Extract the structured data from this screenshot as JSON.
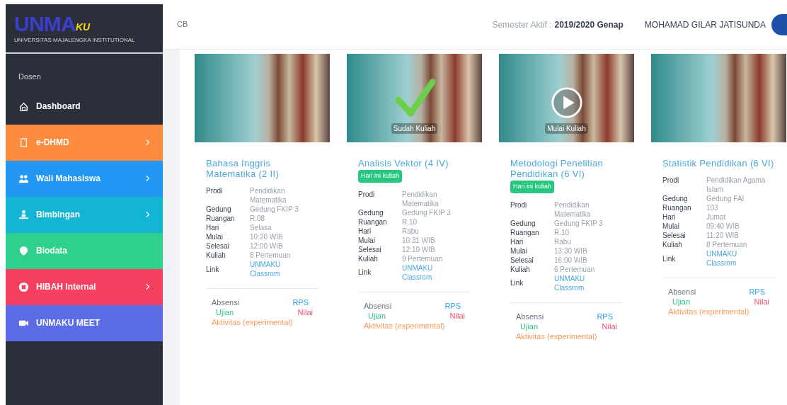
{
  "logo": {
    "text": "UNMA",
    "accent": "KU",
    "tagline": "UNIVERSITAS MAJALENGKA INSTITUTIONAL"
  },
  "header": {
    "toggle": "CB",
    "semester_label": "Semester Aktif :",
    "semester_value": "2019/2020 Genap",
    "user": "MOHAMAD GILAR JATISUNDA"
  },
  "sidebar": {
    "section": "Dosen",
    "items": [
      {
        "label": "Dashboard",
        "color": "#2b2f3a",
        "chevron": false
      },
      {
        "label": "e-DHMD",
        "color": "#fd8c3e",
        "chevron": true
      },
      {
        "label": "Wali Mahasiswa",
        "color": "#2196f3",
        "chevron": true
      },
      {
        "label": "Bimbingan",
        "color": "#13b5d4",
        "chevron": true
      },
      {
        "label": "Biodata",
        "color": "#2fcf8c",
        "chevron": false
      },
      {
        "label": "HIBAH Internal",
        "color": "#f5405f",
        "chevron": true
      },
      {
        "label": "UNMAKU MEET",
        "color": "#5c6be6",
        "chevron": false
      }
    ]
  },
  "courses": [
    {
      "title": "Bahasa Inggris Matematika (2 II)",
      "kind": "plain",
      "details": [
        [
          "Prodi",
          "Pendidikan Matematika"
        ],
        [
          "Gedung",
          "Gedung FKIP 3"
        ],
        [
          "Ruangan",
          "R.08"
        ],
        [
          "Hari",
          "Selasa"
        ],
        [
          "Mulai",
          "10:20 WIB"
        ],
        [
          "Selesai",
          "12:00 WIB"
        ],
        [
          "Kuliah",
          "8 Pertemuan"
        ]
      ],
      "link_label": "Link",
      "link": "UNMAKU Classrom",
      "actions": [
        "Absensi",
        "RPS",
        "Ujian",
        "Nilai",
        "Aktivitas (experimental)"
      ]
    },
    {
      "title": "Analisis Vektor (4 IV)",
      "kind": "check",
      "overlay_text": "Sudah Kuliah",
      "badge": "Hari ini kuliah",
      "details": [
        [
          "Prodi",
          "Pendidikan Matematika"
        ],
        [
          "Gedung",
          "Gedung FKIP 3"
        ],
        [
          "Ruangan",
          "R.10"
        ],
        [
          "Hari",
          "Rabu"
        ],
        [
          "Mulai",
          "10:31 WIB"
        ],
        [
          "Selesai",
          "12:10 WIB"
        ],
        [
          "Kuliah",
          "9 Pertemuan"
        ]
      ],
      "link_label": "Link",
      "link": "UNMAKU Classrom",
      "actions": [
        "Absensi",
        "RPS",
        "Ujian",
        "Nilai",
        "Aktivitas (experimental)"
      ]
    },
    {
      "title": "Metodologi Penelitian Pendidikan (6 VI)",
      "kind": "play",
      "overlay_text": "Mulai Kuliah",
      "badge": "Hari ini kuliah",
      "details": [
        [
          "Prodi",
          "Pendidikan Matematika"
        ],
        [
          "Gedung",
          "Gedung FKIP 3"
        ],
        [
          "Ruangan",
          "R.10"
        ],
        [
          "Hari",
          "Rabu"
        ],
        [
          "Mulai",
          "13:30 WIB"
        ],
        [
          "Selesai",
          "16:00 WIB"
        ],
        [
          "Kuliah",
          "6 Pertemuan"
        ]
      ],
      "link_label": "Link",
      "link": "UNMAKU Classrom",
      "actions": [
        "Absensi",
        "RPS",
        "Ujian",
        "Nilai",
        "Aktivitas (experimental)"
      ]
    },
    {
      "title": "Statistik Pendidikan (6 VI)",
      "kind": "plain",
      "details": [
        [
          "Prodi",
          "Pendidikan Agama Islam"
        ],
        [
          "Gedung",
          "Gedung FAI"
        ],
        [
          "Ruangan",
          "103"
        ],
        [
          "Hari",
          "Jumat"
        ],
        [
          "Mulai",
          "09:40 WIB"
        ],
        [
          "Selesai",
          "11:20 WIB"
        ],
        [
          "Kuliah",
          "8 Pertemuan"
        ]
      ],
      "link_label": "Link",
      "link": "UNMAKU Classrom",
      "actions": [
        "Absensi",
        "RPS",
        "Ujian",
        "Nilai",
        "Aktivitas (experimental)"
      ]
    }
  ]
}
